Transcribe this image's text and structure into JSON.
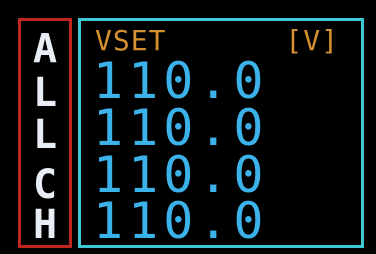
{
  "channel_label": {
    "letters": [
      "A",
      "L",
      "L",
      "C",
      "H"
    ]
  },
  "header": {
    "label": "VSET",
    "unit": "[V]"
  },
  "values": [
    "110.0",
    "110.0",
    "110.0",
    "110.0"
  ],
  "colors": {
    "channel_border": "#c0261f",
    "panel_border": "#3ec8d6",
    "header_text": "#d4912e",
    "value_text": "#3cb2ea",
    "letter_text": "#e9eef6"
  }
}
